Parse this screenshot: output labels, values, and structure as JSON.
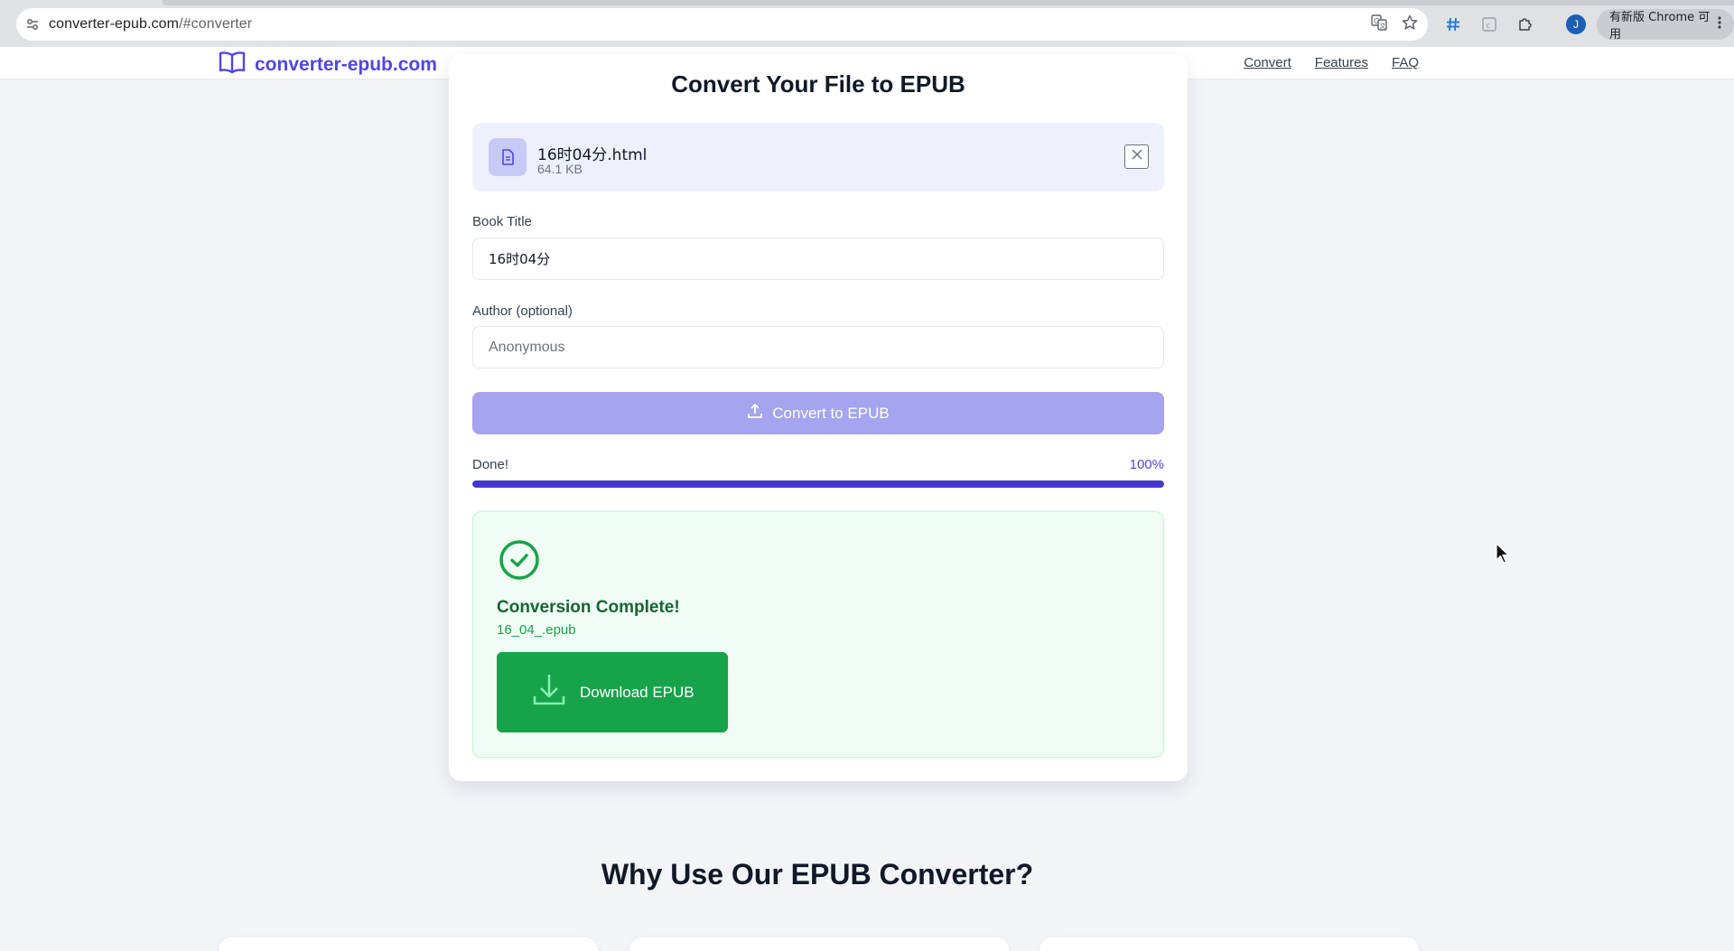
{
  "browser": {
    "url_host": "converter-epub.com",
    "url_path": "/#converter",
    "update_label": "有新版 Chrome 可用",
    "avatar_letter": "J",
    "icons": [
      "site-settings-icon",
      "translate-icon",
      "bookmark-star-icon",
      "hashtag-extension-icon",
      "reader-extension-icon",
      "extensions-puzzle-icon",
      "menu-dots-icon"
    ]
  },
  "header": {
    "brand": "converter-epub.com",
    "nav": [
      "Convert",
      "Features",
      "FAQ"
    ]
  },
  "converter": {
    "title": "Convert Your File to EPUB",
    "file": {
      "name": "16时04分.html",
      "size": "64.1 KB"
    },
    "book_title": {
      "label": "Book Title",
      "value": "16时04分"
    },
    "author": {
      "label": "Author (optional)",
      "placeholder": "Anonymous"
    },
    "convert_button": "Convert to EPUB",
    "progress": {
      "label": "Done!",
      "percent_text": "100%",
      "value": 1.0
    },
    "result": {
      "title": "Conversion Complete!",
      "filename": "16_04_.epub",
      "download_button": "Download EPUB"
    }
  },
  "features": {
    "title": "Why Use Our EPUB Converter?"
  },
  "colors": {
    "brand": "#4f46e5",
    "convert_button_disabled": "#a5a4ee",
    "progress": "#4338ca",
    "success_bg": "#f0fdf4",
    "success_text": "#166534",
    "download_button": "#16a34a"
  }
}
